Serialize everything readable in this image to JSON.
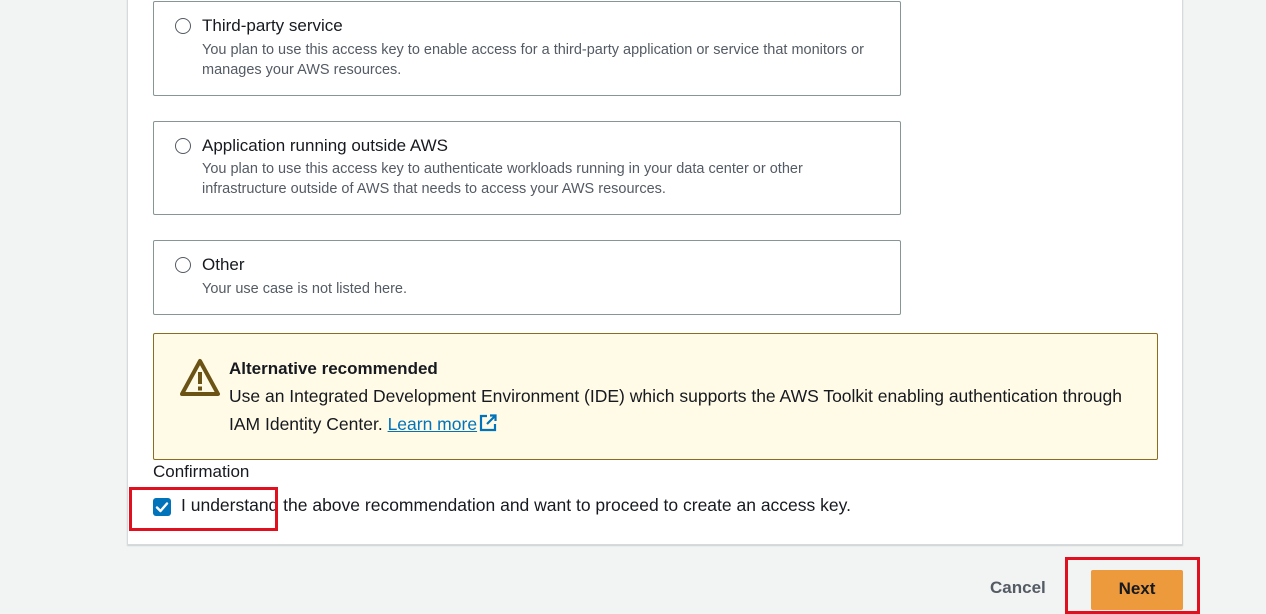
{
  "options": [
    {
      "title": "Third-party service",
      "description": "You plan to use this access key to enable access for a third-party application or service that monitors or manages your AWS resources."
    },
    {
      "title": "Application running outside AWS",
      "description": "You plan to use this access key to authenticate workloads running in your data center or other infrastructure outside of AWS that needs to access your AWS resources."
    },
    {
      "title": "Other",
      "description": "Your use case is not listed here."
    }
  ],
  "alert": {
    "title": "Alternative recommended",
    "body": "Use an Integrated Development Environment (IDE) which supports the AWS Toolkit enabling authentication through IAM Identity Center.",
    "link": "Learn more",
    "icon": "warning-icon"
  },
  "confirmation": {
    "label": "Confirmation",
    "checkbox_text": "I understand the above recommendation and want to proceed to create an access key.",
    "checked": true
  },
  "actions": {
    "cancel": "Cancel",
    "next": "Next"
  },
  "colors": {
    "primary_button": "#ec9a3c",
    "checkbox": "#0073bb",
    "highlight": "#e0101e",
    "alert_bg": "#fffbe6"
  }
}
